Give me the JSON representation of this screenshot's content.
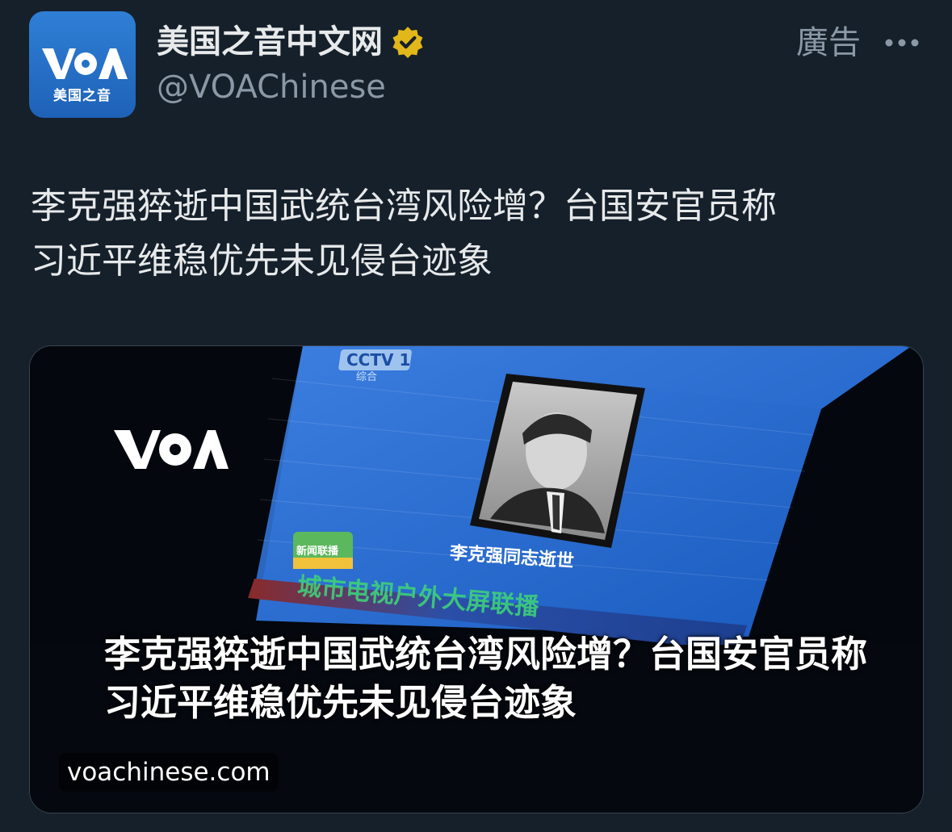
{
  "account": {
    "display_name": "美国之音中文网",
    "handle": "@VOAChinese",
    "avatar_logo_text": "VOA",
    "avatar_sub_text": "美国之音"
  },
  "header": {
    "ad_label": "廣告"
  },
  "tweet": {
    "text": "李克强猝逝中国武统台湾风险增？台国安官员称\n习近平维稳优先未见侵台迹象"
  },
  "media": {
    "watermark_logo": "VOA",
    "caption": "李克强猝逝中国武统台湾风险增？台国安官员称习近平维稳优先未见侵台迹象",
    "screen_channel": "CCTV 1",
    "screen_channel_sub": "综合",
    "screen_portrait_caption": "李克强同志逝世",
    "screen_program_logo": "新闻联播",
    "screen_banner": "城市电视户外大屏联播",
    "link_domain": "voachinese.com"
  },
  "colors": {
    "background": "#15202b",
    "text_primary": "#e7e9ea",
    "text_secondary": "#8b98a5",
    "verified_gold": "#e2b719",
    "voa_blue": "#2272c9"
  }
}
